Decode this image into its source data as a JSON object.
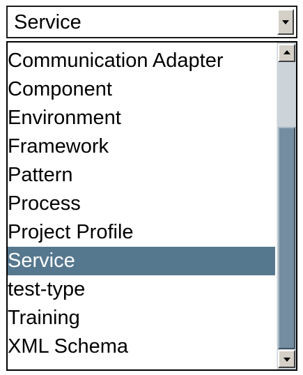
{
  "select": {
    "value": "Service"
  },
  "dropdown": {
    "items": [
      {
        "label": "Communication Adapter"
      },
      {
        "label": "Component"
      },
      {
        "label": "Environment"
      },
      {
        "label": "Framework"
      },
      {
        "label": "Pattern"
      },
      {
        "label": "Process"
      },
      {
        "label": "Project Profile"
      },
      {
        "label": "Service"
      },
      {
        "label": "test-type"
      },
      {
        "label": "Training"
      },
      {
        "label": "XML Schema"
      }
    ],
    "selected_label": "Service"
  },
  "colors": {
    "selected_bg": "#56788f",
    "scroll_thumb": "#758da0",
    "scroll_track": "#ccd3d9"
  },
  "icons": {
    "select_toggle": "chevron-down-icon",
    "scroll_up": "arrow-up-icon",
    "scroll_down": "arrow-down-icon"
  }
}
